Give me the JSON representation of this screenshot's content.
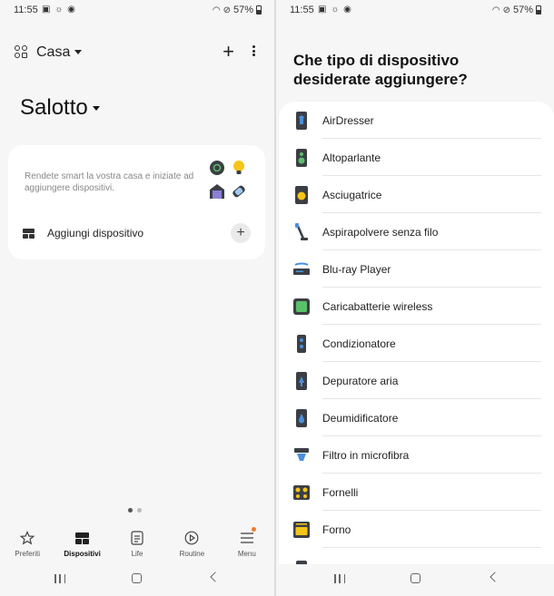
{
  "status": {
    "time": "11:55",
    "battery": "57%",
    "icons": [
      "image-icon",
      "sun-icon",
      "sync-icon"
    ],
    "right_icons": [
      "wifi-icon",
      "dnd-icon",
      "battery-icon"
    ]
  },
  "left": {
    "home_title": "Casa",
    "room_title": "Salotto",
    "card": {
      "description": "Rendete smart la vostra casa e iniziate ad aggiungere dispositivi.",
      "add_label": "Aggiungi dispositivo"
    },
    "pager": {
      "count": 2,
      "active": 0
    },
    "nav": [
      {
        "label": "Preferiti",
        "icon": "star-icon"
      },
      {
        "label": "Dispositivi",
        "icon": "devices-icon",
        "active": true
      },
      {
        "label": "Life",
        "icon": "life-icon"
      },
      {
        "label": "Routine",
        "icon": "routine-icon"
      },
      {
        "label": "Menu",
        "icon": "menu-icon",
        "badge": true
      }
    ]
  },
  "right": {
    "question": "Che tipo di dispositivo desiderate aggiungere?",
    "devices": [
      {
        "label": "AirDresser",
        "icon": "airdresser-icon"
      },
      {
        "label": "Altoparlante",
        "icon": "speaker-icon"
      },
      {
        "label": "Asciugatrice",
        "icon": "dryer-icon"
      },
      {
        "label": "Aspirapolvere senza filo",
        "icon": "stick-vacuum-icon"
      },
      {
        "label": "Blu-ray Player",
        "icon": "bluray-icon"
      },
      {
        "label": "Caricabatterie wireless",
        "icon": "wireless-charger-icon"
      },
      {
        "label": "Condizionatore",
        "icon": "air-conditioner-icon"
      },
      {
        "label": "Depuratore aria",
        "icon": "air-purifier-icon"
      },
      {
        "label": "Deumidificatore",
        "icon": "dehumidifier-icon"
      },
      {
        "label": "Filtro in microfibra",
        "icon": "microfiber-filter-icon"
      },
      {
        "label": "Fornelli",
        "icon": "cooktop-icon"
      },
      {
        "label": "Forno",
        "icon": "oven-icon"
      }
    ]
  },
  "colors": {
    "accent_orange": "#f07a2a",
    "icon_yellow": "#f5c518",
    "icon_dark": "#3b3f45",
    "icon_blue": "#4a90d9",
    "icon_green": "#5bc06a"
  }
}
